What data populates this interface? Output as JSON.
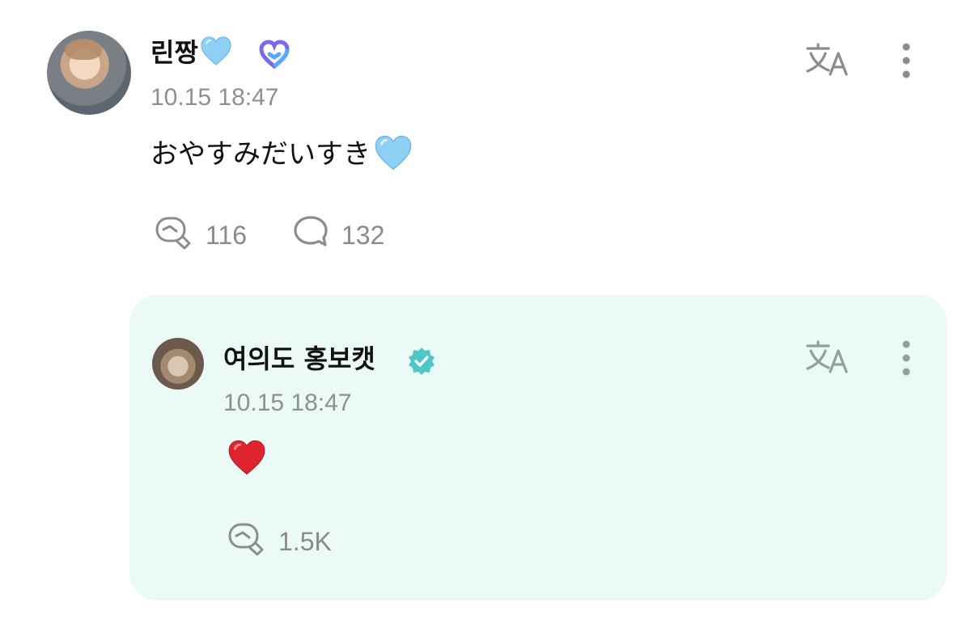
{
  "post": {
    "author": "린짱",
    "timestamp": "10.15 18:47",
    "text": "おやすみだいすき",
    "like_count": "116",
    "comment_count": "132"
  },
  "reply": {
    "author": "여의도 홍보캣",
    "timestamp": "10.15 18:47",
    "like_count": "1.5K"
  },
  "icons": {
    "post_heart": "light-blue-heart-icon",
    "post_badge": "ring-badge-icon",
    "translate": "translate-icon",
    "more": "more-vertical-icon",
    "like": "like-icon",
    "comment": "comment-icon",
    "verified": "verified-check-icon",
    "reply_emoji": "red-heart-emoji"
  },
  "colors": {
    "light_blue_heart": "#8ecff5",
    "badge_purple": "#7b68ee",
    "badge_blue": "#5aa7ff",
    "verified_teal": "#4ec7c6",
    "red_heart": "#e0242f",
    "reply_card_bg": "#ebfaf6",
    "meta_gray": "#8f8f8f"
  }
}
